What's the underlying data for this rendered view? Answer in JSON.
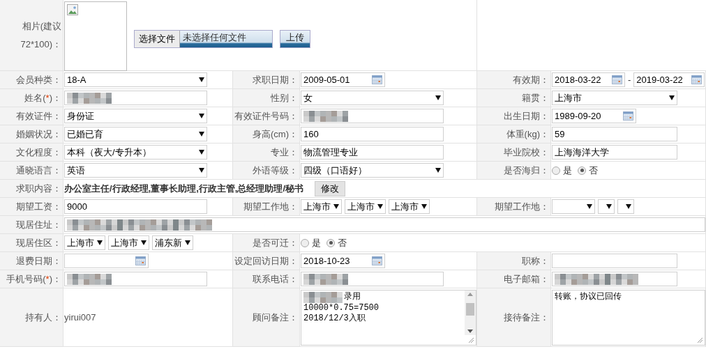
{
  "rows": [
    {
      "cells": [
        {
          "label": "相片(建议72*100)：",
          "field": {
            "kind": "photo",
            "choose_button": "选择文件",
            "file_status": "未选择任何文件",
            "upload_button": "上传"
          }
        }
      ]
    },
    {
      "cells": [
        {
          "label": "会员种类：",
          "field": {
            "kind": "select",
            "value": "18-A"
          }
        },
        {
          "label": "求职日期：",
          "field": {
            "kind": "date",
            "value": "2009-05-01"
          }
        },
        {
          "label": "有效期：",
          "field": {
            "kind": "date_range",
            "from": "2018-03-22",
            "separator": "-",
            "to": "2019-03-22"
          }
        }
      ]
    },
    {
      "cells": [
        {
          "label": "姓名(",
          "mark": "*",
          "label_end": ")：",
          "field": {
            "kind": "text",
            "redacted": true
          }
        },
        {
          "label": "性别：",
          "field": {
            "kind": "select",
            "value": "女"
          }
        },
        {
          "label": "籍贯：",
          "field": {
            "kind": "select",
            "value": "上海市"
          }
        }
      ]
    },
    {
      "cells": [
        {
          "label": "有效证件：",
          "field": {
            "kind": "select",
            "value": "身份证"
          }
        },
        {
          "label": "有效证件号码：",
          "field": {
            "kind": "text",
            "redacted": true
          }
        },
        {
          "label": "出生日期：",
          "field": {
            "kind": "date",
            "value": "1989-09-20"
          }
        }
      ]
    },
    {
      "cells": [
        {
          "label": "婚姻状况：",
          "field": {
            "kind": "select",
            "value": "已婚已育"
          }
        },
        {
          "label": "身高(cm)：",
          "field": {
            "kind": "text",
            "value": "160"
          }
        },
        {
          "label": "体重(kg)：",
          "field": {
            "kind": "text",
            "value": "59"
          }
        }
      ]
    },
    {
      "cells": [
        {
          "label": "文化程度：",
          "field": {
            "kind": "select",
            "value": "本科（夜大/专升本）"
          }
        },
        {
          "label": "专业：",
          "field": {
            "kind": "text",
            "value": "物流管理专业"
          }
        },
        {
          "label": "毕业院校：",
          "field": {
            "kind": "text",
            "value": "上海海洋大学"
          }
        }
      ]
    },
    {
      "cells": [
        {
          "label": "通晓语言：",
          "field": {
            "kind": "select",
            "value": "英语"
          }
        },
        {
          "label": "外语等级：",
          "field": {
            "kind": "select",
            "value": "四级（口语好）"
          }
        },
        {
          "label": "是否海归：",
          "field": {
            "kind": "radio",
            "options": [
              {
                "label": "是",
                "selected": false
              },
              {
                "label": "否",
                "selected": true
              }
            ]
          }
        }
      ]
    },
    {
      "cells": [
        {
          "label": "求职内容：",
          "field": {
            "kind": "static",
            "value": "办公室主任/行政经理,董事长助理,行政主管,总经理助理/秘书",
            "bold": true,
            "button": "修改"
          }
        }
      ]
    },
    {
      "cells": [
        {
          "label": "期望工资：",
          "field": {
            "kind": "text",
            "value": "9000"
          }
        },
        {
          "label": "期望工作地：",
          "field": {
            "kind": "selects",
            "selects": [
              {
                "kind": "filled",
                "value": "上海市"
              },
              {
                "kind": "filled",
                "value": "上海市"
              },
              {
                "kind": "filled",
                "value": "上海市"
              }
            ]
          }
        },
        {
          "label": "期望工作地：",
          "field": {
            "kind": "selects",
            "selects": [
              {
                "kind": "blank"
              },
              {
                "kind": "blank"
              },
              {
                "kind": "blank"
              }
            ]
          }
        }
      ]
    },
    {
      "cells": [
        {
          "label": "现居住址：",
          "field": {
            "kind": "wide_text",
            "redacted": true
          }
        }
      ]
    },
    {
      "cells": [
        {
          "label": "现居住区：",
          "field": {
            "kind": "selects",
            "selects": [
              {
                "kind": "filled",
                "value": "上海市"
              },
              {
                "kind": "filled",
                "value": "上海市"
              },
              {
                "kind": "filled",
                "value": "浦东新"
              }
            ]
          }
        },
        {
          "label": "是否可迁：",
          "field": {
            "kind": "radio",
            "options": [
              {
                "label": "是",
                "selected": false
              },
              {
                "label": "否",
                "selected": true
              }
            ]
          }
        }
      ]
    },
    {
      "cells": [
        {
          "label": "退费日期：",
          "field": {
            "kind": "date"
          }
        },
        {
          "label": "设定回访日期：",
          "field": {
            "kind": "date",
            "value": "2018-10-23"
          }
        },
        {
          "label": "职称：",
          "field": {
            "kind": "text"
          }
        }
      ]
    },
    {
      "cells": [
        {
          "label": "手机号码(",
          "mark": "*",
          "label_end": ")：",
          "field": {
            "kind": "text",
            "redacted": true
          }
        },
        {
          "label": "联系电话：",
          "field": {
            "kind": "text",
            "redacted": true
          }
        },
        {
          "label": "电子邮箱：",
          "field": {
            "kind": "text",
            "redacted": true
          }
        }
      ]
    },
    {
      "cells": [
        {
          "label": "持有人：",
          "field": {
            "kind": "static",
            "value": "yirui007"
          }
        },
        {
          "label": "顾问备注：",
          "field": {
            "kind": "textarea",
            "scrollbar": true,
            "lines": [
              {
                "redacted_prefix": true,
                "text": "录用"
              },
              {
                "text": "10000*0.75=7500"
              },
              {
                "text": "2018/12/3入职"
              }
            ]
          }
        },
        {
          "label": "接待备注：",
          "field": {
            "kind": "textarea",
            "lines": [
              {
                "text": "转账，协议已回传"
              }
            ]
          }
        }
      ]
    }
  ]
}
